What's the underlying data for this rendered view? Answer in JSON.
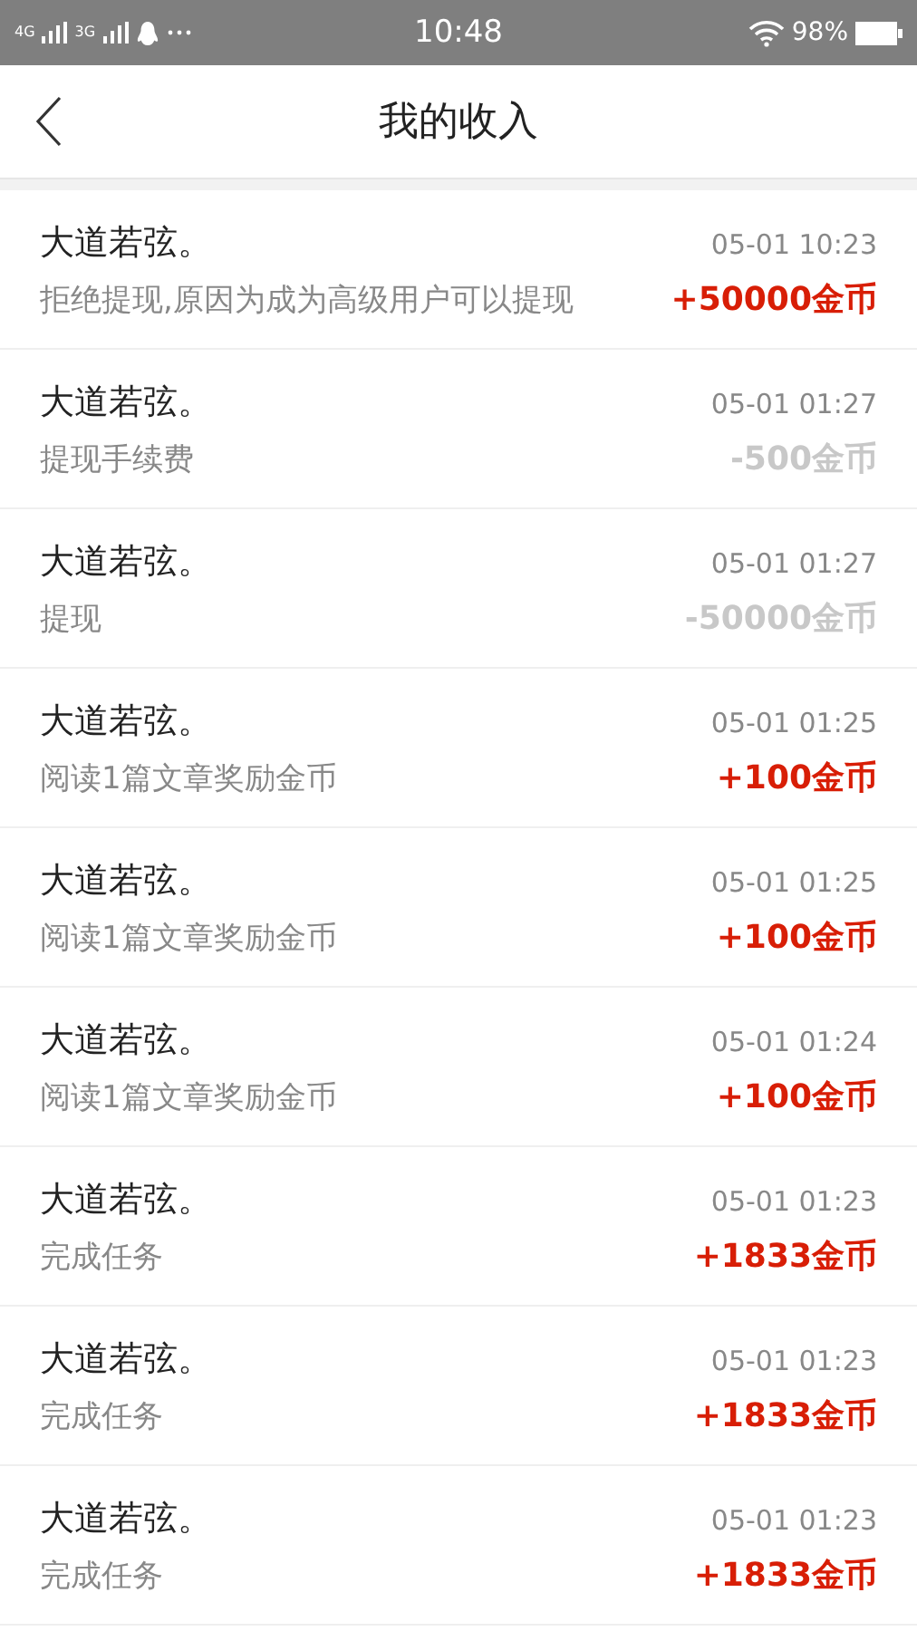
{
  "status_bar": {
    "network_1": "4G",
    "network_2": "3G",
    "time": "10:48",
    "battery": "98%"
  },
  "header": {
    "title": "我的收入"
  },
  "records": [
    {
      "name": "大道若弦。",
      "time": "05-01 10:23",
      "description": "拒绝提现,原因为成为高级用户可以提现",
      "amount": "+50000金币",
      "kind": "income"
    },
    {
      "name": "大道若弦。",
      "time": "05-01 01:27",
      "description": "提现手续费",
      "amount": "-500金币",
      "kind": "expense"
    },
    {
      "name": "大道若弦。",
      "time": "05-01 01:27",
      "description": "提现",
      "amount": "-50000金币",
      "kind": "expense"
    },
    {
      "name": "大道若弦。",
      "time": "05-01 01:25",
      "description": "阅读1篇文章奖励金币",
      "amount": "+100金币",
      "kind": "income"
    },
    {
      "name": "大道若弦。",
      "time": "05-01 01:25",
      "description": "阅读1篇文章奖励金币",
      "amount": "+100金币",
      "kind": "income"
    },
    {
      "name": "大道若弦。",
      "time": "05-01 01:24",
      "description": "阅读1篇文章奖励金币",
      "amount": "+100金币",
      "kind": "income"
    },
    {
      "name": "大道若弦。",
      "time": "05-01 01:23",
      "description": "完成任务",
      "amount": "+1833金币",
      "kind": "income"
    },
    {
      "name": "大道若弦。",
      "time": "05-01 01:23",
      "description": "完成任务",
      "amount": "+1833金币",
      "kind": "income"
    },
    {
      "name": "大道若弦。",
      "time": "05-01 01:23",
      "description": "完成任务",
      "amount": "+1833金币",
      "kind": "income"
    }
  ]
}
